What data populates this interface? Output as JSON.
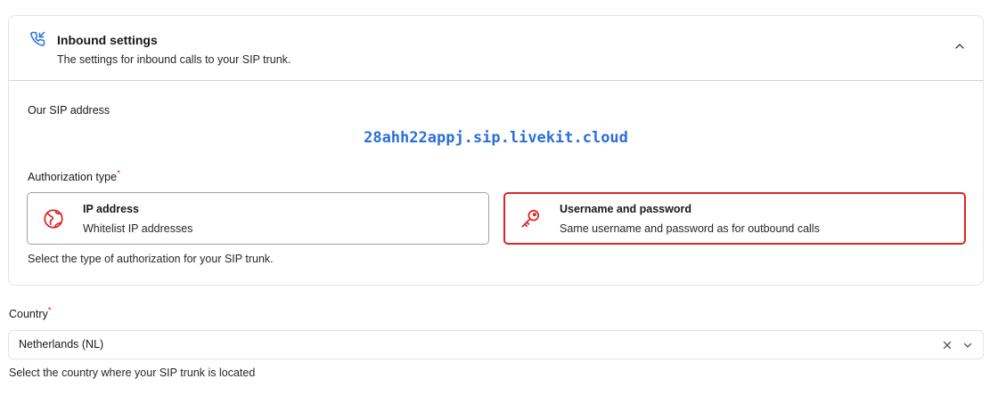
{
  "inbound": {
    "title": "Inbound settings",
    "subtitle": "The settings for inbound calls to your SIP trunk.",
    "icon": "phone-incoming-icon",
    "collapse_icon": "chevron-up-icon"
  },
  "sip": {
    "label": "Our SIP address",
    "address": "28ahh22appj.sip.livekit.cloud",
    "address_color": "#2a6fd8"
  },
  "auth": {
    "label": "Authorization type",
    "required_mark": "*",
    "options": [
      {
        "title": "IP address",
        "description": "Whitelist IP addresses",
        "icon": "globe-icon",
        "selected": false
      },
      {
        "title": "Username and password",
        "description": "Same username and password as for outbound calls",
        "icon": "key-icon",
        "selected": true
      }
    ],
    "help": "Select the type of authorization for your SIP trunk.",
    "accent": "#dc2626"
  },
  "country": {
    "label": "Country",
    "required_mark": "*",
    "value": "Netherlands (NL)",
    "help": "Select the country where your SIP trunk is located"
  }
}
